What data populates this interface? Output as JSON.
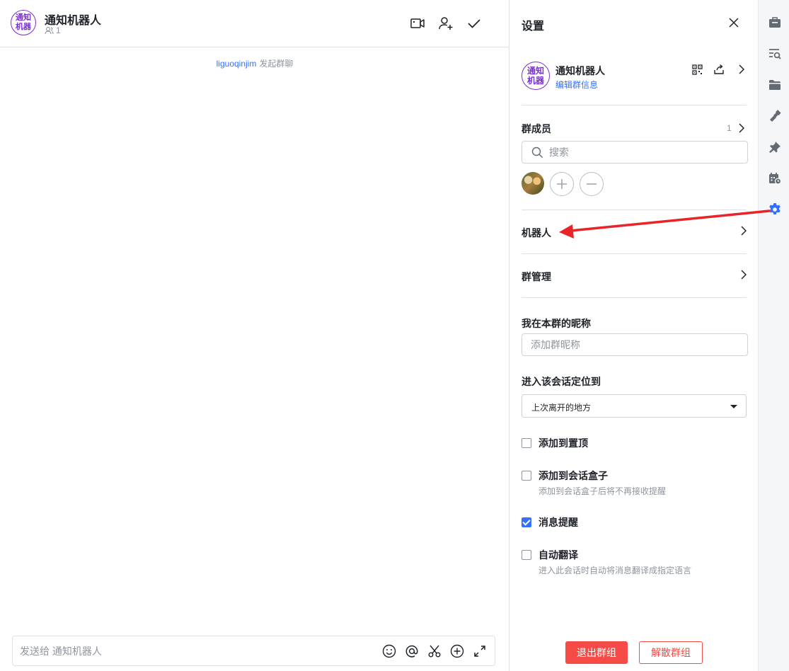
{
  "chat": {
    "title": "通知机器人",
    "avatar_text": "通知机器",
    "member_count": "1",
    "system_message": {
      "user": "liguoqinjim",
      "action": "发起群聊"
    },
    "composer_placeholder": "发送给 通知机器人"
  },
  "settings": {
    "title": "设置",
    "group": {
      "name": "通知机器人",
      "avatar_text": "通知机器",
      "edit_link": "编辑群信息"
    },
    "members": {
      "label": "群成员",
      "count": "1",
      "search_placeholder": "搜索"
    },
    "bots_label": "机器人",
    "group_manage_label": "群管理",
    "nickname": {
      "label": "我在本群的昵称",
      "placeholder": "添加群昵称"
    },
    "locate": {
      "label": "进入该会话定位到",
      "selected": "上次离开的地方"
    },
    "options": [
      {
        "label": "添加到置顶",
        "desc": "",
        "checked": false
      },
      {
        "label": "添加到会话盒子",
        "desc": "添加到会话盒子后将不再接收提醒",
        "checked": false
      },
      {
        "label": "消息提醒",
        "desc": "",
        "checked": true
      },
      {
        "label": "自动翻译",
        "desc": "进入此会话时自动将消息翻译成指定语言",
        "checked": false
      }
    ],
    "leave_button": "退出群组",
    "disband_button": "解散群组"
  },
  "colors": {
    "accent": "#3370ff",
    "danger": "#f54a45",
    "avatar": "#7b2fd6",
    "annotation": "#e8232a"
  },
  "icons": {
    "header": [
      "video-icon",
      "add-member-icon",
      "check-icon"
    ],
    "composer": [
      "emoji-icon",
      "at-icon",
      "scissors-icon",
      "plus-circle-icon",
      "expand-icon"
    ],
    "rail": [
      "briefcase-icon",
      "search-list-icon",
      "folder-icon",
      "wrench-icon",
      "pin-icon",
      "calendar-icon",
      "gear-icon"
    ]
  }
}
